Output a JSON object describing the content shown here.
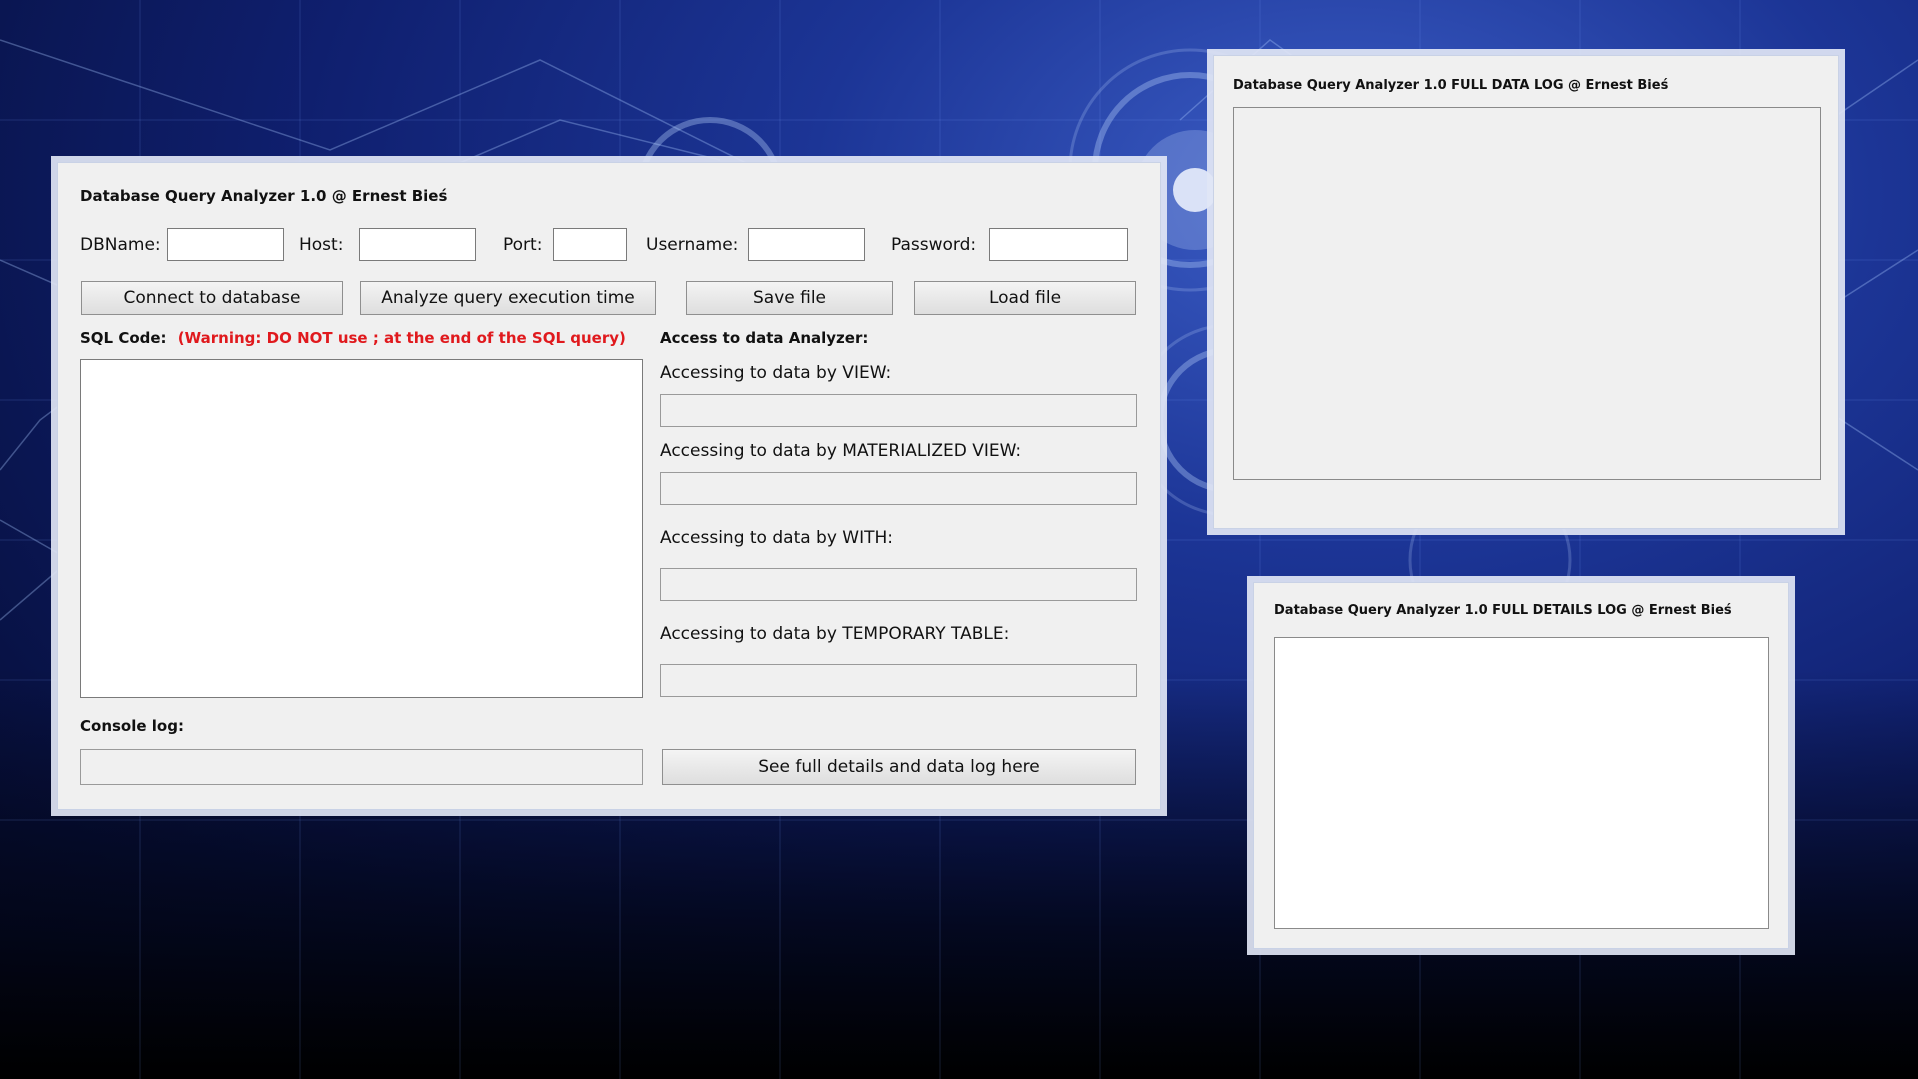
{
  "main_window": {
    "title": "Database Query Analyzer 1.0 @ Ernest Bieś",
    "fields": {
      "dbname_label": "DBName:",
      "host_label": "Host:",
      "port_label": "Port:",
      "username_label": "Username:",
      "password_label": "Password:"
    },
    "buttons": {
      "connect": "Connect to database",
      "analyze": "Analyze query execution time",
      "save": "Save file",
      "load": "Load file",
      "see_full": "See full details and data log here"
    },
    "sql": {
      "label": "SQL Code:",
      "warning": "(Warning: DO NOT use ; at the end of the SQL query)"
    },
    "analyzer": {
      "heading": "Access to data Analyzer:",
      "view_label": "Accessing to data by VIEW:",
      "materialized_label": "Accessing to data by MATERIALIZED VIEW:",
      "with_label": "Accessing to data by WITH:",
      "temp_label": "Accessing to data by TEMPORARY TABLE:"
    },
    "console": {
      "label": "Console log:"
    }
  },
  "data_log_window": {
    "title": "Database Query Analyzer 1.0  FULL DATA LOG @ Ernest Bieś"
  },
  "details_log_window": {
    "title": "Database Query Analyzer 1.0  FULL DETAILS LOG @ Ernest Bieś"
  },
  "colors": {
    "warning": "#e0191d",
    "window_bg": "#f0f0f0",
    "desktop_blue": "#0f1f6e"
  }
}
